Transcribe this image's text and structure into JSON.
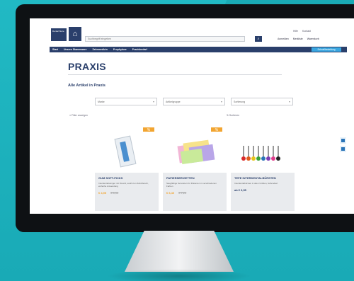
{
  "site": {
    "logo_text": "Dental Store",
    "search_placeholder": "Suchbegriff eingeben",
    "search_icon": "search-icon",
    "top_links": [
      "Hilfe",
      "Kontakt"
    ],
    "account_links": [
      "Anmelden",
      "Merkliste",
      "Warenkorb"
    ]
  },
  "nav": {
    "items": [
      "Start",
      "Unsere Stammware",
      "Zahnmedizin",
      "Prophylaxe",
      "Praxisbedarf"
    ],
    "cta": "Schnellbestellung"
  },
  "page": {
    "title": "PRAXIS",
    "subtitle": "Alle Artikel in Praxis"
  },
  "filters": [
    {
      "label": "Marke"
    },
    {
      "label": "Artikelgruppe"
    },
    {
      "label": "Sortierung"
    }
  ],
  "listing": {
    "filter_toggle": "Filter anzeigen",
    "sort_label": "Sortieren"
  },
  "products": [
    {
      "name": "GUM SOFT-PICKS",
      "desc": "Interdentalreiniger mit Fluorid, sanft zum Zahnfleisch, einfache Anwendung",
      "price": "€ 4,95",
      "old_price": "€ 5,90",
      "badge": "%",
      "image": "toothbrush-pack"
    },
    {
      "name": "PAPIERSERVIETTEN",
      "desc": "Saugfähige Servietten für Patienten in verschiedenen Farben",
      "price": "€ 6,40",
      "old_price": "€ 7,20",
      "badge": "%",
      "image": "colored-napkins"
    },
    {
      "name": "TEPE INTERDENTALBÜRSTEN",
      "desc": "Interdentalbürsten in allen Größen, farbcodiert",
      "price": "ab € 3,95",
      "old_price": "",
      "badge": "",
      "image": "interdental-brushes"
    }
  ],
  "colors": {
    "brand": "#2a3f6b",
    "accent": "#f2a531",
    "background": "#21b9c4"
  }
}
